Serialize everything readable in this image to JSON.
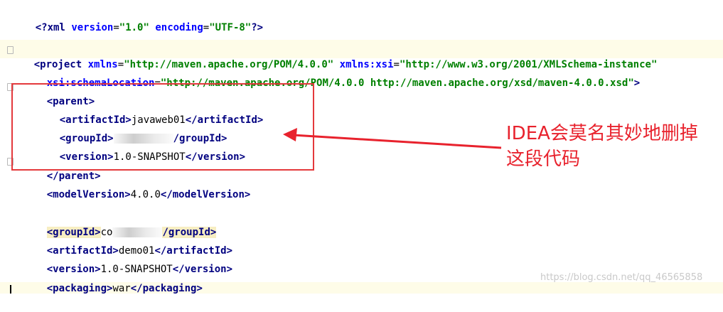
{
  "editor": {
    "lines": {
      "l1": {
        "decl_open": "<?",
        "decl_name": "xml",
        "a1": "version",
        "v1": "\"1.0\"",
        "a2": "encoding",
        "v2": "\"UTF-8\"",
        "decl_close": "?>"
      },
      "l3": {
        "open": "<project",
        "a1": "xmlns",
        "v1": "\"http://maven.apache.org/POM/4.0.0\"",
        "a2": "xmlns:xsi",
        "v2": "\"http://www.w3.org/2001/XMLSchema-instance\""
      },
      "l4": {
        "a1": "xsi:schemaLocation",
        "v1": "\"http://maven.apache.org/POM/4.0.0 http://maven.apache.org/xsd/maven-4.0.0.xsd\"",
        "close": ">"
      },
      "parent_open": "<parent>",
      "parent_close": "</parent>",
      "artifact1": {
        "open": "<artifactId>",
        "text": "javaweb01",
        "close": "</artifactId>"
      },
      "group1": {
        "open": "<groupId>",
        "text": "co",
        "close": "/groupId>"
      },
      "version1": {
        "open": "<version>",
        "text": "1.0-SNAPSHOT",
        "close": "</version>"
      },
      "model": {
        "open": "<modelVersion>",
        "text": "4.0.0",
        "close": "</modelVersion>"
      },
      "group2": {
        "open": "<groupId>",
        "text": "co",
        "close": "/groupId>"
      },
      "artifact2": {
        "open": "<artifactId>",
        "text": "demo01",
        "close": "</artifactId>"
      },
      "version2": {
        "open": "<version>",
        "text": "1.0-SNAPSHOT",
        "close": "</version>"
      },
      "packaging": {
        "open": "<packaging>",
        "text": "war",
        "close": "</packaging>"
      }
    }
  },
  "annotation": {
    "line1": "IDEA会莫名其妙地删掉",
    "line2": "这段代码",
    "color": "#e8222d"
  },
  "watermark": "https://blog.csdn.net/qq_46565858"
}
